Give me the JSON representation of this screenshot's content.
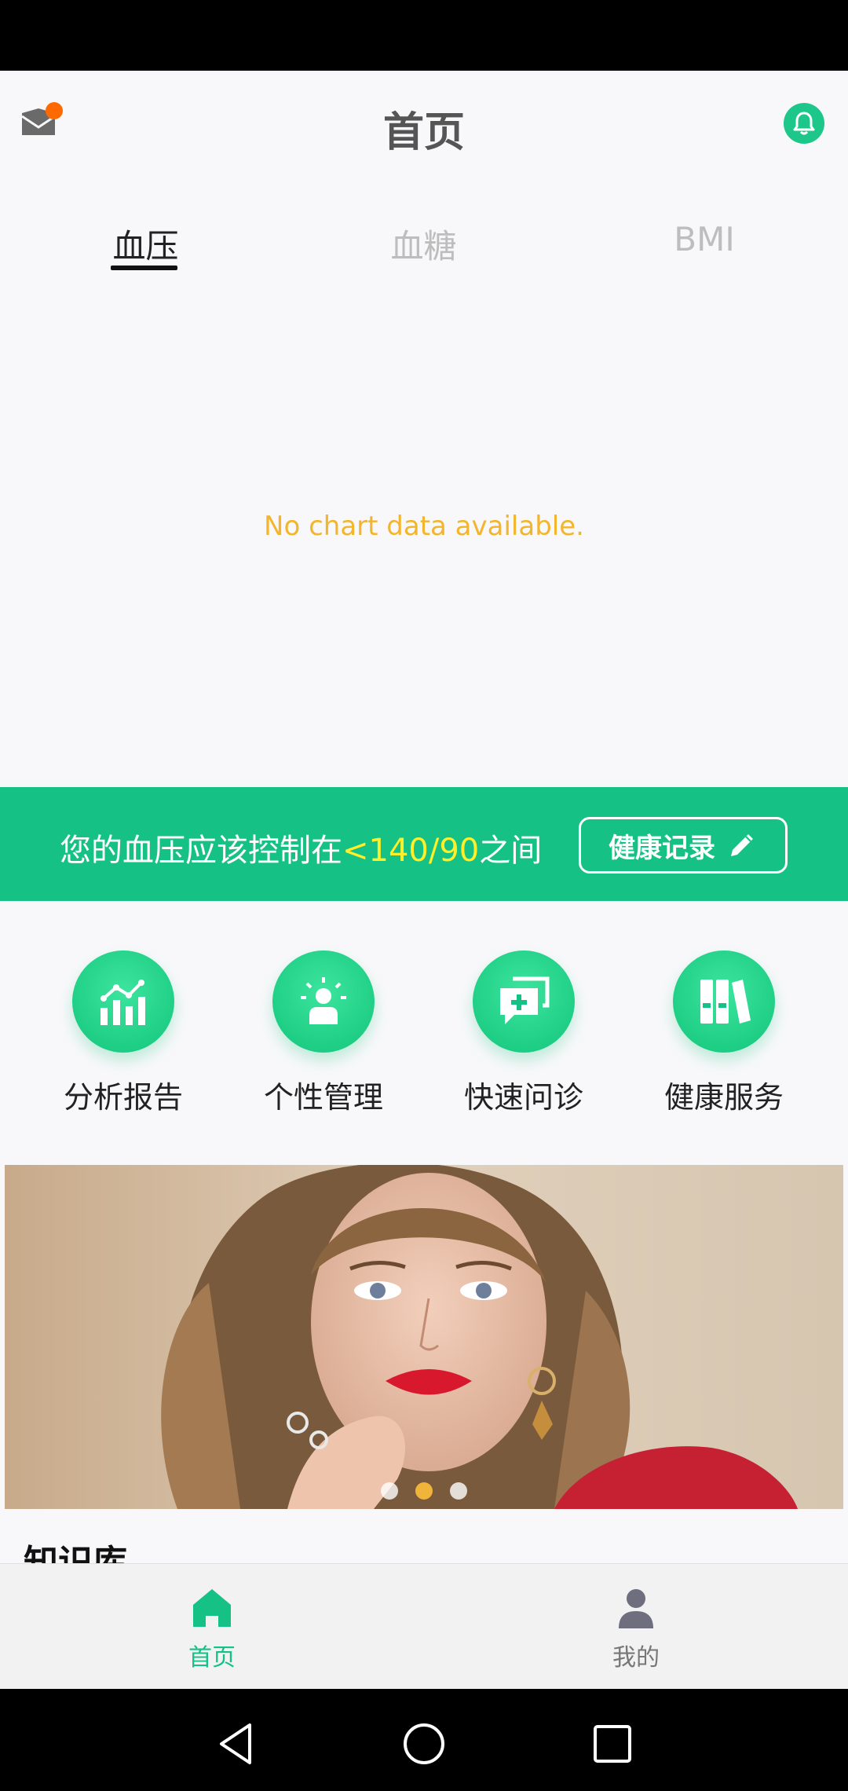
{
  "header": {
    "title": "首页",
    "mail_icon": "mail-icon",
    "bell_icon": "bell-icon"
  },
  "tabs": [
    {
      "label": "血压",
      "active": true
    },
    {
      "label": "血糖",
      "active": false
    },
    {
      "label": "BMI",
      "active": false
    }
  ],
  "chart": {
    "empty_message": "No chart data available."
  },
  "bp_banner": {
    "text_before": "您的血压应该控制在",
    "range": "<140/90",
    "text_after": "之间",
    "button_label": "健康记录"
  },
  "quick_actions": [
    {
      "label": "分析报告",
      "icon": "chart-analysis-icon"
    },
    {
      "label": "个性管理",
      "icon": "person-manage-icon"
    },
    {
      "label": "快速问诊",
      "icon": "chat-consult-icon"
    },
    {
      "label": "健康服务",
      "icon": "binders-icon"
    }
  ],
  "carousel": {
    "slide_count": 3,
    "active_index": 1
  },
  "knowledge": {
    "title": "知识库"
  },
  "bottom_nav": [
    {
      "label": "首页",
      "icon": "home-icon",
      "active": true
    },
    {
      "label": "我的",
      "icon": "user-icon",
      "active": false
    }
  ],
  "colors": {
    "primary": "#15c185",
    "highlight": "#ffef2a",
    "empty_text": "#f2b52b",
    "dot_active": "#f0b43a"
  }
}
